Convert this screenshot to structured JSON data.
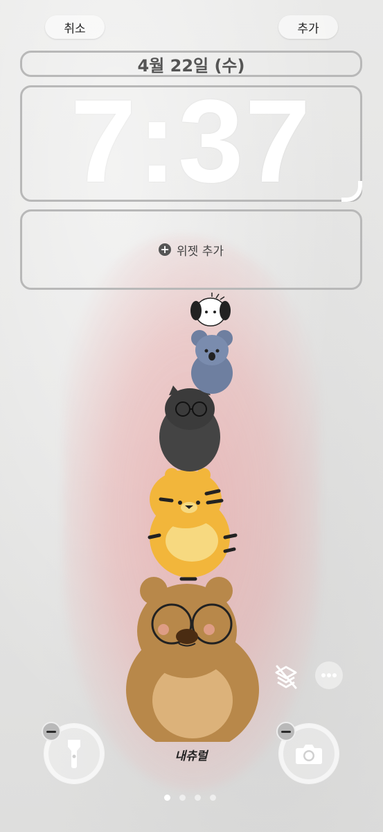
{
  "header": {
    "cancel_label": "취소",
    "add_label": "추가"
  },
  "date": {
    "text": "4월 22일 (수)"
  },
  "clock": {
    "time": "7:37"
  },
  "widgets": {
    "add_label": "위젯 추가"
  },
  "wallpaper": {
    "signature": "내츄럴"
  },
  "page_indicator": {
    "count": 4,
    "active_index": 0
  },
  "icons": {
    "cancel": "none",
    "flashlight": "flashlight-icon",
    "camera": "camera-icon",
    "depth_effect": "layers-slash-icon",
    "more": "ellipsis-icon"
  },
  "colors": {
    "background": "#e6e6e6",
    "pink_wash": "#ec9696",
    "clock": "#ffffff",
    "frame": "#b8b8b8"
  }
}
